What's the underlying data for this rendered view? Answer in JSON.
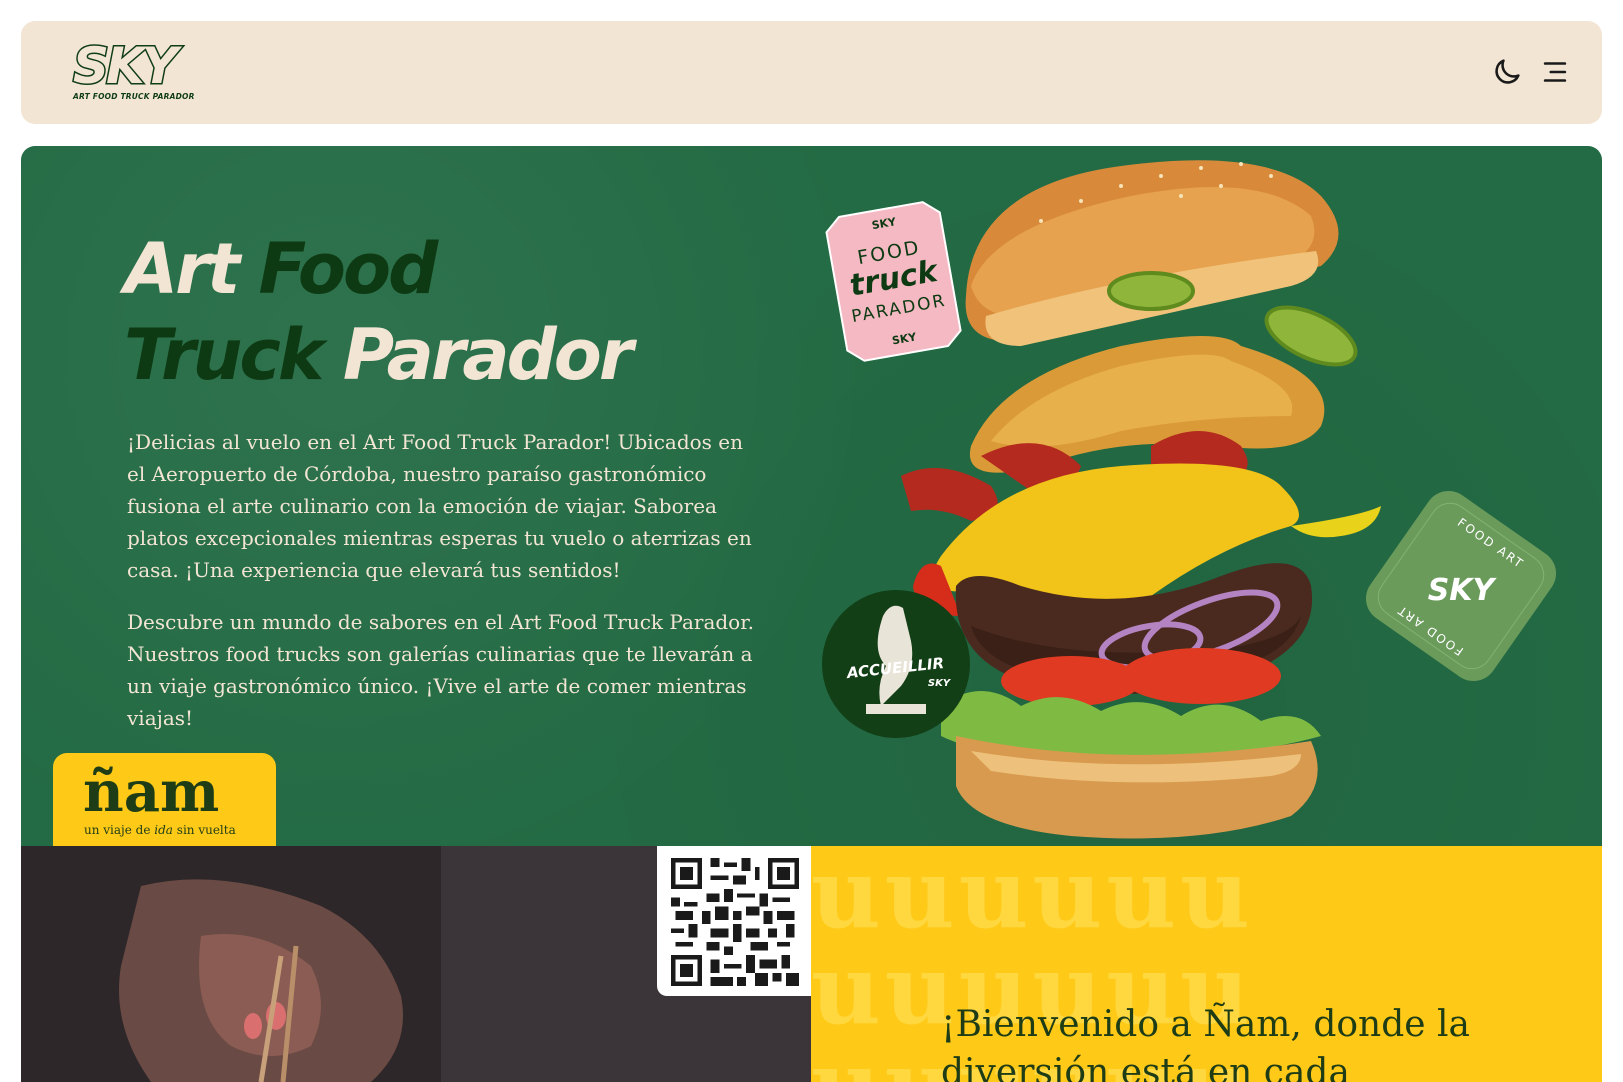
{
  "header": {
    "logo_text": "SKY",
    "logo_subtitle": "ART FOOD TRUCK PARADOR",
    "theme_toggle_icon": "moon-icon",
    "menu_icon": "menu-icon"
  },
  "hero": {
    "title": {
      "word1": "Art",
      "word2": "Food",
      "word3": "Truck",
      "word4": "Parador"
    },
    "paragraph1": "¡Delicias al vuelo en el Art Food Truck Parador! Ubicados en el Aeropuerto de Córdoba, nuestro paraíso gastronómico fusiona el arte culinario con la emoción de viajar. Saborea platos excepcionales mientras esperas tu vuelo o aterrizas en casa. ¡Una experiencia que elevará tus sentidos!",
    "paragraph2": "Descubre un mundo de sabores en el Art Food Truck Parador. Nuestros food trucks son galerías culinarias que te llevarán a un viaje gastronómico único. ¡Vive el arte de comer mientras viajas!",
    "stickers": {
      "pink": {
        "top": "SKY",
        "line1": "FOOD",
        "line2": "truck",
        "line3": "PARADOR",
        "bottom": "SKY"
      },
      "dark_circle": {
        "main": "ACCUEILLIR",
        "sub": "SKY"
      },
      "green_badge": {
        "center": "SKY",
        "ring": "FOOD ART FOOD ART FOOD ART FOOD ART"
      }
    },
    "brand_colors": {
      "green": "#236b44",
      "cream": "#f3e5d4",
      "dark_green": "#0d3a12",
      "yellow": "#ffc917"
    }
  },
  "nam": {
    "logo": "ñam",
    "tagline_before": "un viaje de ",
    "tagline_italic": "ida",
    "tagline_after": " sin vuelta"
  },
  "welcome": {
    "pattern_letters": "uuuuuu",
    "text": "¡Bienvenido a Ñam, donde la diversión está en cada"
  }
}
